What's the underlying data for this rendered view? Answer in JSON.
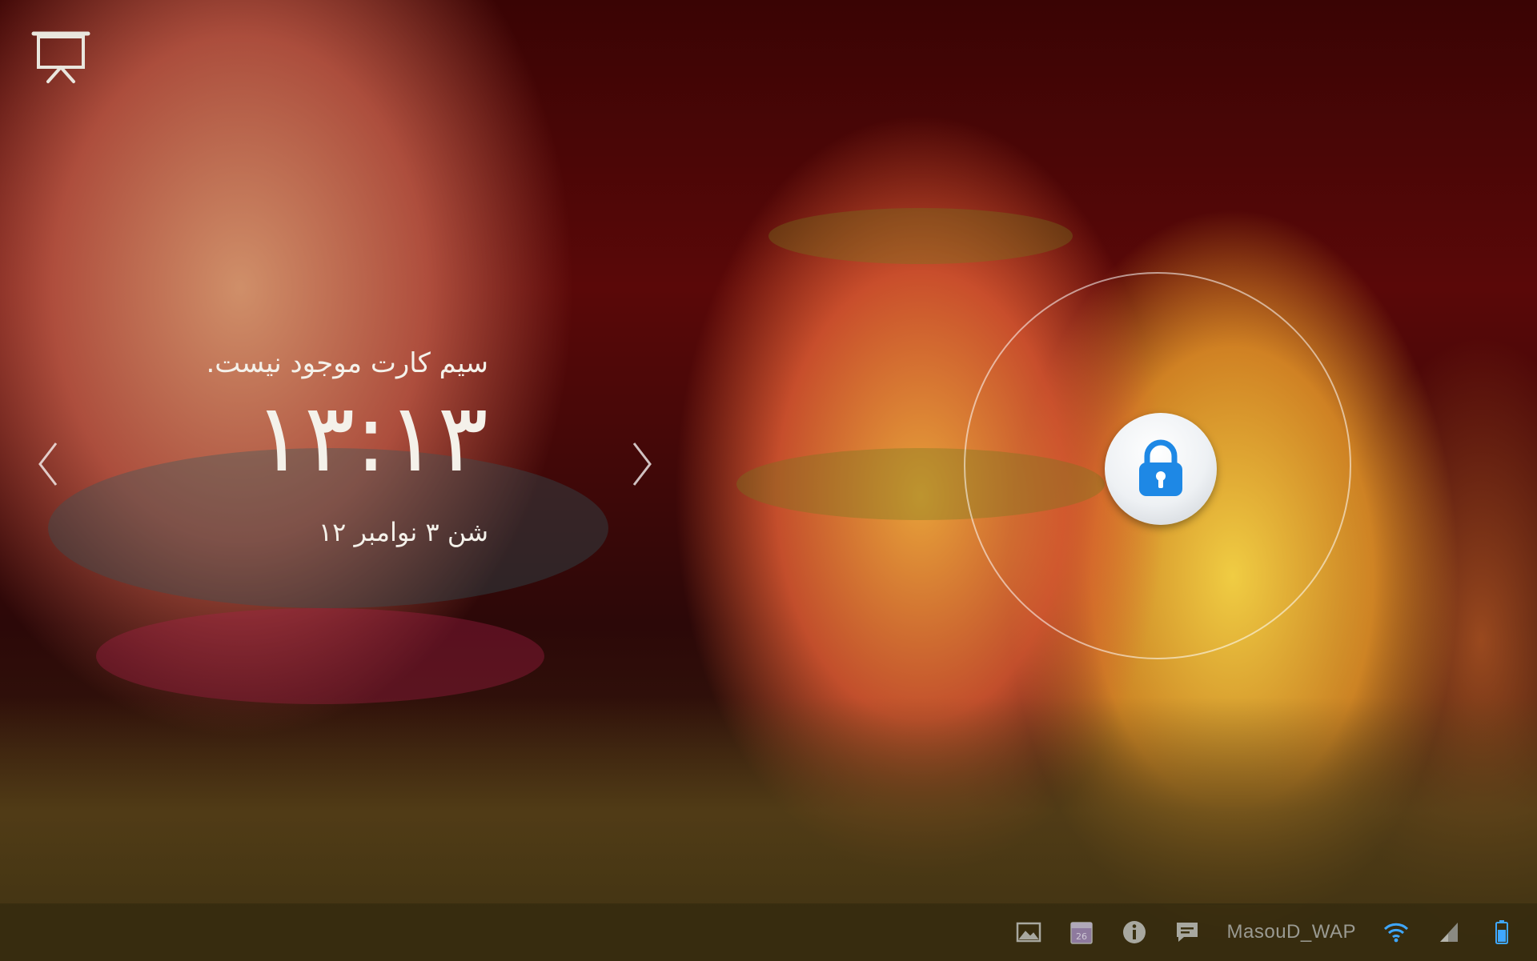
{
  "lockscreen": {
    "carrier_text": "سیم کارت موجود نیست.",
    "clock": "۱۳:۱۳",
    "date": "شن ۳ نوامبر ۱۲"
  },
  "status_bar": {
    "network_name": "MasouD_WAP",
    "icons": [
      "image-notification-icon",
      "calendar-notification-icon",
      "info-icon",
      "message-icon",
      "wifi-icon",
      "signal-icon",
      "battery-icon"
    ]
  },
  "colors": {
    "lock_accent": "#1e88e5",
    "text": "#f4f1ea",
    "status_bar_bg": "#372d0f"
  }
}
